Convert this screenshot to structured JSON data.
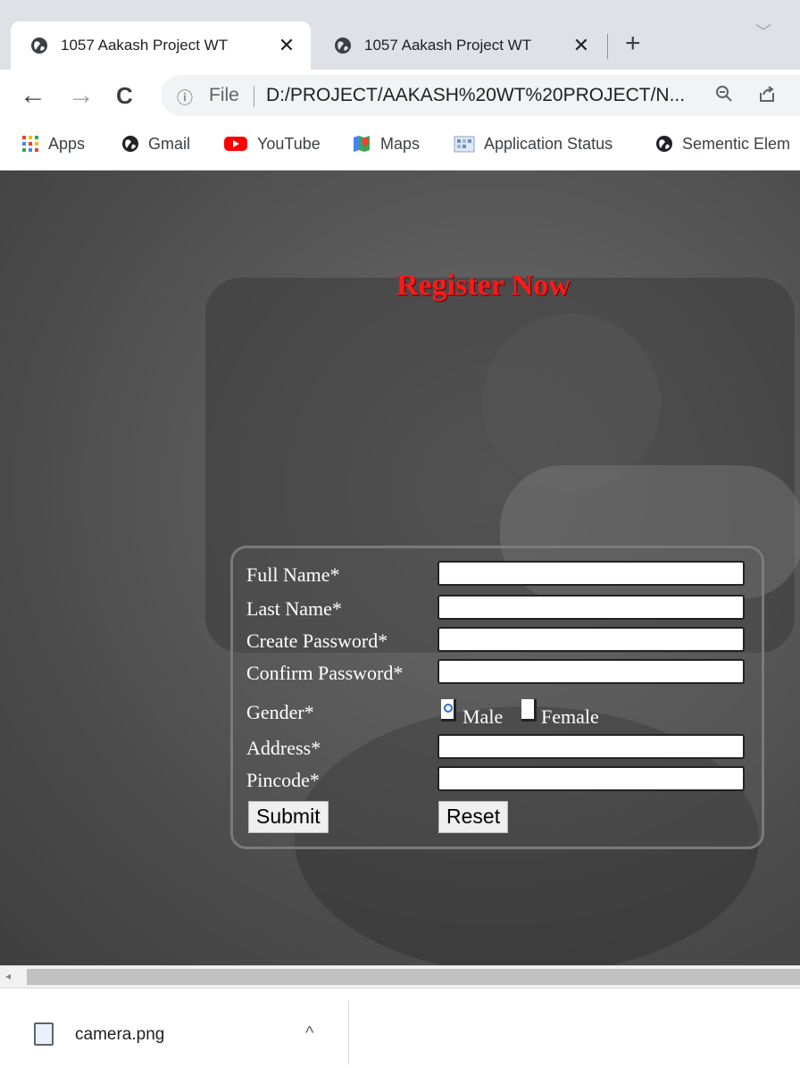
{
  "tabs": [
    {
      "title": "1057 Aakash Project WT",
      "close": "✕",
      "active": true
    },
    {
      "title": "1057 Aakash Project WT",
      "close": "✕",
      "active": false
    }
  ],
  "toolbar": {
    "new_tab": "+",
    "back": "←",
    "forward": "→",
    "reload": "C",
    "info_icon": "ⓘ",
    "scheme_label": "File",
    "url": "D:/PROJECT/AAKASH%20WT%20PROJECT/N...",
    "zoom_icon": "🔍",
    "share_icon": "⇪"
  },
  "bookmarks": [
    {
      "label": "Apps",
      "icon": "apps-grid-icon"
    },
    {
      "label": "Gmail",
      "icon": "globe-icon"
    },
    {
      "label": "YouTube",
      "icon": "youtube-icon"
    },
    {
      "label": "Maps",
      "icon": "maps-icon"
    },
    {
      "label": "Application Status",
      "icon": "app-status-icon"
    },
    {
      "label": "Sementic Elem",
      "icon": "globe-icon"
    }
  ],
  "page": {
    "heading": "Register Now",
    "heading_color": "#ff1a1a",
    "form": {
      "full_name_label": "Full Name*",
      "full_name_value": "",
      "last_name_label": "Last Name*",
      "last_name_value": "",
      "create_password_label": "Create Password*",
      "create_password_value": "",
      "confirm_password_label": "Confirm Password*",
      "confirm_password_value": "",
      "gender_label": "Gender*",
      "gender_options": [
        "Male",
        "Female"
      ],
      "gender_selected": "Male",
      "address_label": "Address*",
      "address_value": "",
      "pincode_label": "Pincode*",
      "pincode_value": "",
      "submit_label": "Submit",
      "reset_label": "Reset"
    }
  },
  "downloads": {
    "file_name": "camera.png",
    "caret": "^"
  }
}
